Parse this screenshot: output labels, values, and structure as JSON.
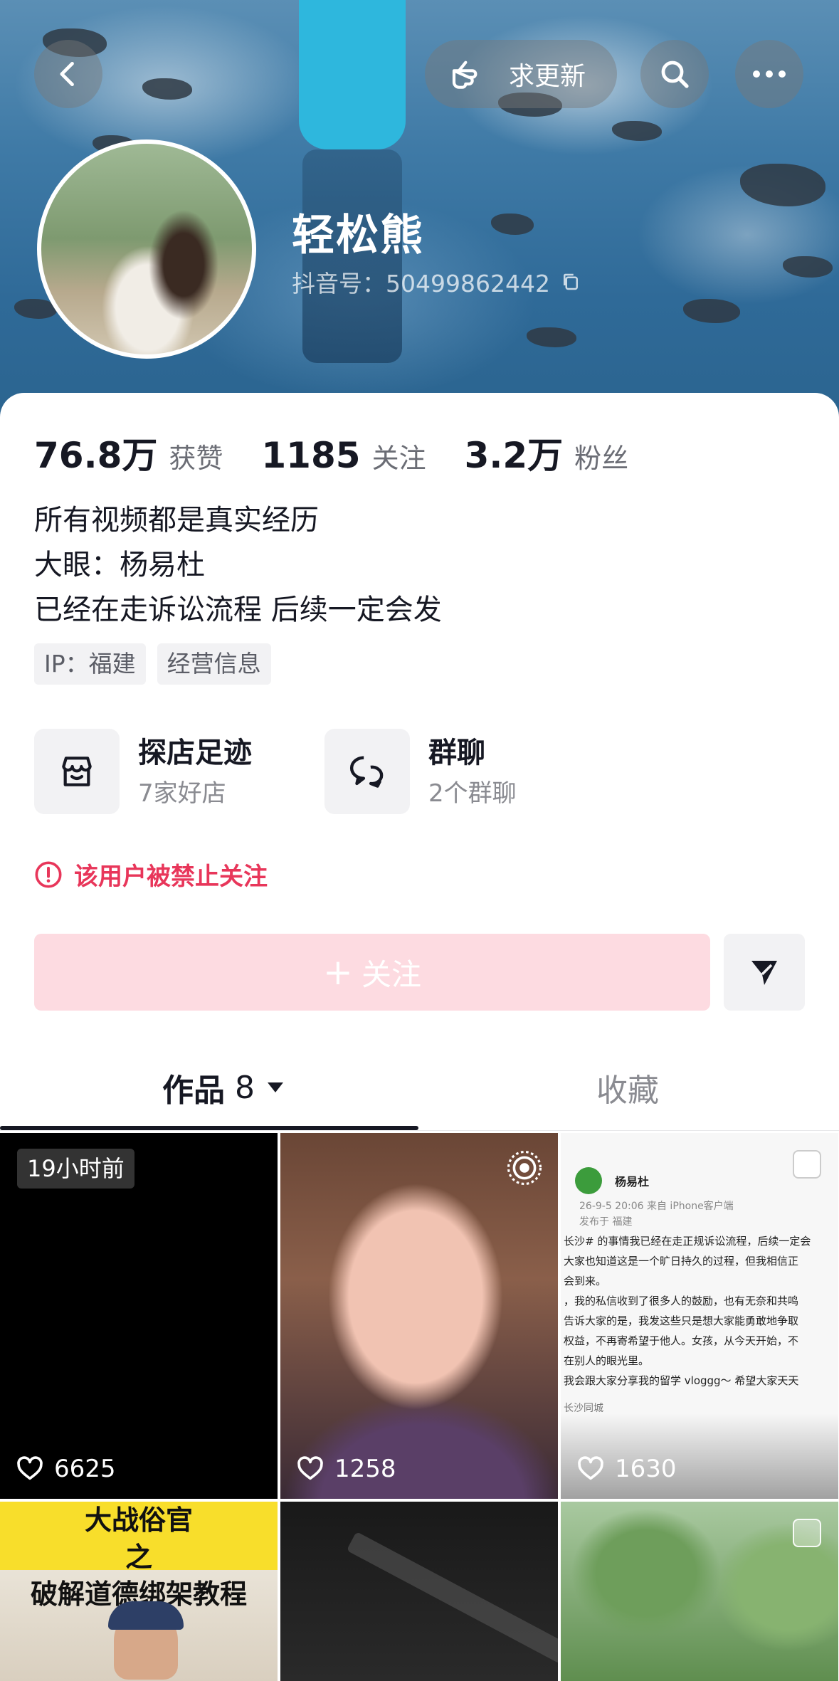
{
  "header": {
    "request_update_label": "求更新"
  },
  "profile": {
    "name": "轻松熊",
    "douyin_id": "抖音号：50499862442"
  },
  "stats": [
    {
      "value": "76.8万",
      "label": "获赞"
    },
    {
      "value": "1185",
      "label": "关注"
    },
    {
      "value": "3.2万",
      "label": "粉丝"
    }
  ],
  "bio": [
    "所有视频都是真实经历",
    "大眼：杨易杜",
    "已经在走诉讼流程 后续一定会发"
  ],
  "tags": [
    "IP：福建",
    "经营信息"
  ],
  "features": {
    "store": {
      "title": "探店足迹",
      "subtitle": "7家好店"
    },
    "group": {
      "title": "群聊",
      "subtitle": "2个群聊"
    }
  },
  "notice": "该用户被禁止关注",
  "follow_label": "关注",
  "tabs": {
    "works_label": "作品",
    "works_count": "8",
    "favorites_label": "收藏"
  },
  "videos": [
    {
      "badge": "19小时前",
      "likes": "6625"
    },
    {
      "likes": "1258"
    },
    {
      "likes": "1630",
      "post_author": "杨易杜",
      "post_meta_1": "26-9-5 20:06 来自 iPhone客户端",
      "post_meta_2": "发布于 福建",
      "post_lines": [
        "长沙# 的事情我已经在走正规诉讼流程，后续一定会",
        "大家也知道这是一个旷日持久的过程，但我相信正",
        "会到来。",
        "，我的私信收到了很多人的鼓励，也有无奈和共鸣",
        "告诉大家的是，我发这些只是想大家能勇敢地争取",
        "权益，不再寄希望于他人。女孩，从今天开始，不",
        "在别人的眼光里。",
        "我会跟大家分享我的留学 vloggg～ 希望大家天天"
      ],
      "post_footer": "长沙同城"
    },
    {
      "poster_line_1": "大战俗官",
      "poster_line_2": "之",
      "poster_line_3": "破解道德绑架教程"
    },
    {},
    {}
  ],
  "colors": {
    "accent_red": "#e8365a",
    "follow_disabled_bg": "#fddbe1",
    "text_primary": "#161823",
    "text_secondary": "#8a8b91"
  }
}
